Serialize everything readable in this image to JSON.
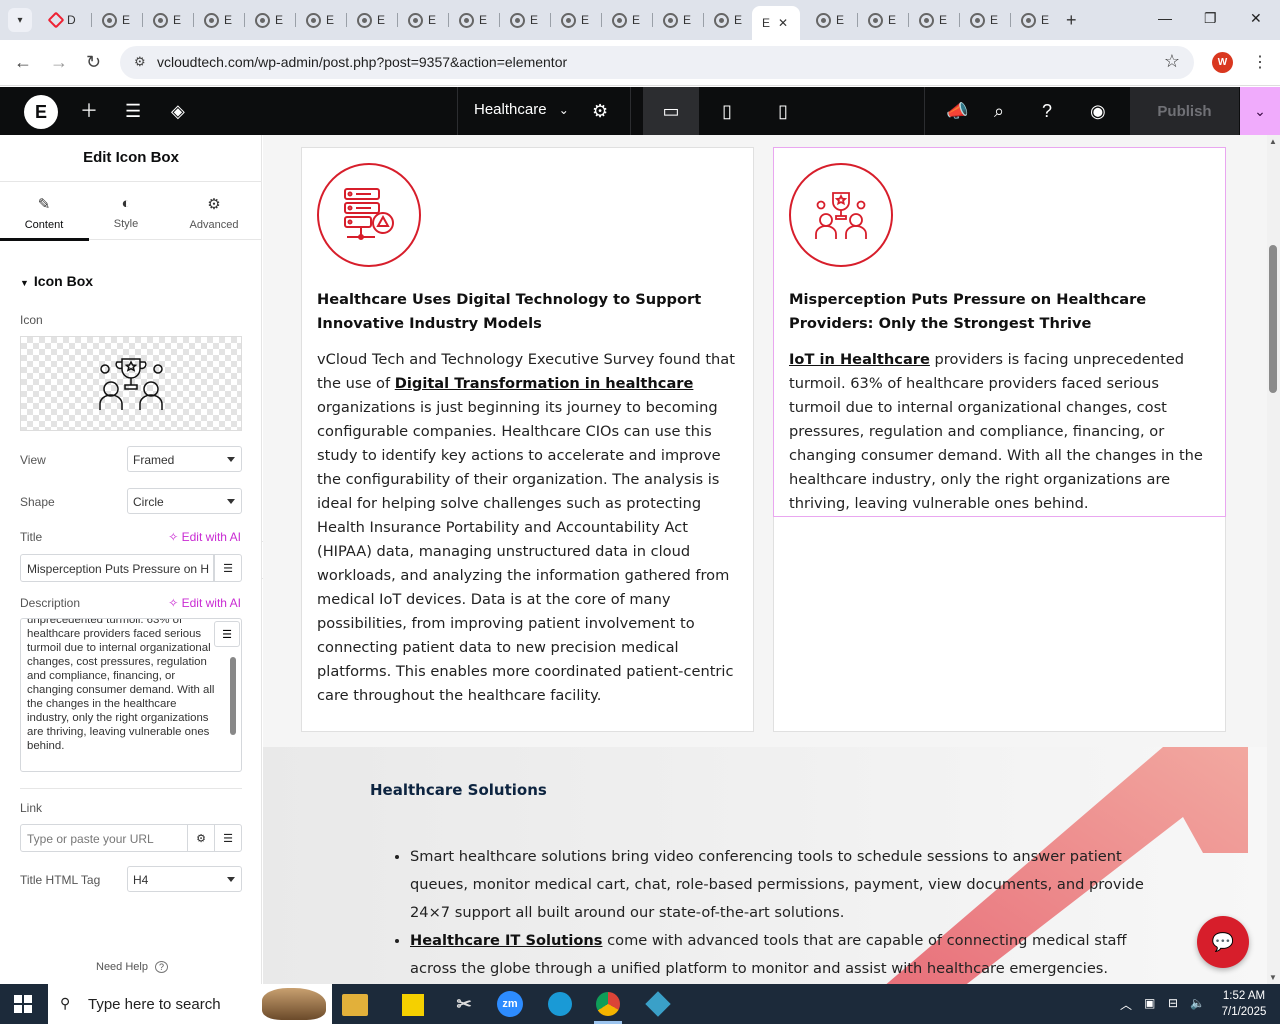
{
  "browser": {
    "tabs": [
      {
        "label": "E"
      },
      {
        "label": "E"
      },
      {
        "label": "E"
      },
      {
        "label": "E"
      },
      {
        "label": "E"
      },
      {
        "label": "E"
      },
      {
        "label": "E"
      },
      {
        "label": "E"
      },
      {
        "label": "E"
      },
      {
        "label": "E"
      },
      {
        "label": "E"
      },
      {
        "label": "E"
      },
      {
        "label": "E"
      },
      {
        "label": "E"
      },
      {
        "label": "E"
      },
      {
        "label": "E"
      },
      {
        "label": "E"
      }
    ],
    "first_tab_label": "D",
    "active_tab_label": "E",
    "url": "vcloudtech.com/wp-admin/post.php?post=9357&action=elementor",
    "profile_initial": "W"
  },
  "toolbar": {
    "logo": "E",
    "page_name": "Healthcare",
    "publish_label": "Publish"
  },
  "panel": {
    "title": "Edit Icon Box",
    "tabs": [
      {
        "label": "Content",
        "icon": "pencil-icon"
      },
      {
        "label": "Style",
        "icon": "half-circle-icon"
      },
      {
        "label": "Advanced",
        "icon": "gear-icon"
      }
    ],
    "section_title": "Icon Box",
    "icon_label": "Icon",
    "view_label": "View",
    "view_value": "Framed",
    "shape_label": "Shape",
    "shape_value": "Circle",
    "title_label": "Title",
    "edit_with_ai": "Edit with AI",
    "title_value": "Misperception Puts Pressure on H",
    "description_label": "Description",
    "description_value": "unprecedented turmoil. 63% of healthcare providers faced serious turmoil due to internal organizational changes, cost pressures, regulation and compliance, financing, or changing consumer demand. With all the changes in the healthcare industry, only the right organizations are thriving, leaving vulnerable ones behind.",
    "link_label": "Link",
    "link_placeholder": "Type or paste your URL",
    "html_tag_label": "Title HTML Tag",
    "html_tag_value": "H4",
    "need_help": "Need Help"
  },
  "preview": {
    "card1": {
      "title": "Healthcare Uses Digital Technology to Support Innovative Industry Models",
      "body_pre": "vCloud Tech and Technology Executive Survey found that the use of ",
      "body_link": "Digital Transformation in healthcare",
      "body_post": " organizations is just beginning its journey to becoming configurable companies. Healthcare CIOs can use this study to identify key actions to accelerate and improve the configurability of their organization. The analysis is ideal for helping solve challenges such as protecting Health Insurance Portability and Accountability Act (HIPAA) data, managing unstructured data in cloud workloads, and analyzing the information gathered from medical IoT devices. Data is at the core of many possibilities, from improving patient involvement to connecting patient data to new precision medical platforms. This enables more coordinated patient-centric care throughout the healthcare facility."
    },
    "card2": {
      "title": "Misperception Puts Pressure on Healthcare Providers: Only the Strongest Thrive",
      "body_link": "IoT in Healthcare",
      "body_post": " providers is facing unprecedented turmoil. 63% of healthcare providers faced serious turmoil due to internal organizational changes, cost pressures, regulation and compliance, financing, or changing consumer demand. With all the changes in the healthcare industry, only the right organizations are thriving, leaving vulnerable ones behind."
    },
    "solutions": {
      "title": "Healthcare Solutions",
      "item1": "Smart healthcare solutions bring video conferencing tools to schedule sessions to answer patient queues, monitor medical cart, chat, role-based permissions, payment, view documents, and provide 24×7 support all built around our state-of-the-art solutions.",
      "item2_link": "Healthcare IT Solutions",
      "item2_post": " come with advanced tools that are capable of connecting medical staff across the globe through a unified platform to monitor and assist with healthcare emergencies."
    }
  },
  "taskbar": {
    "search_placeholder": "Type here to search",
    "time": "1:52 AM",
    "date": "7/1/2025"
  },
  "colors": {
    "accent_red": "#d71e2b",
    "elementor_pink": "#f0abfc",
    "toolbar_bg": "#0c0d0e"
  }
}
